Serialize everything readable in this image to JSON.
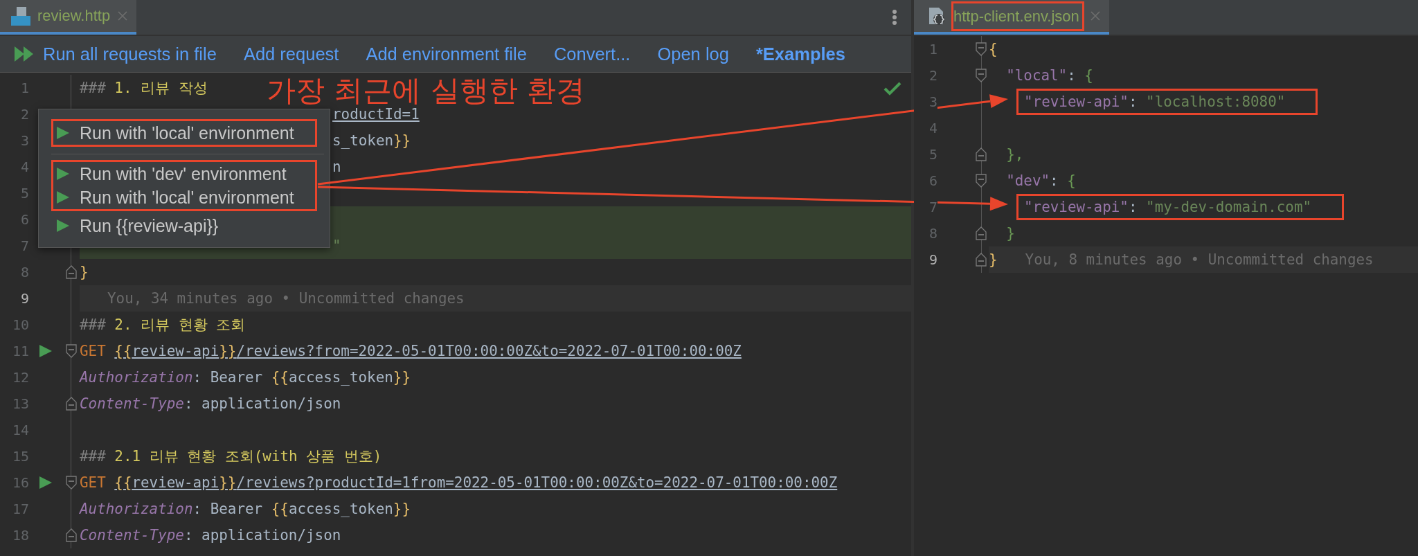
{
  "left_editor": {
    "tab": {
      "title": "review.http",
      "selected": true
    },
    "toolbar": [
      {
        "kind": "run",
        "label": "Run all requests in file"
      },
      {
        "kind": "link",
        "label": "Add request"
      },
      {
        "kind": "link",
        "label": "Add environment file"
      },
      {
        "kind": "link",
        "label": "Convert..."
      },
      {
        "kind": "link",
        "label": "Open log"
      },
      {
        "kind": "bold",
        "label": "*Examples"
      }
    ],
    "annotation": "가장 최근에 실행한 환경",
    "lines": [
      {
        "number": "1",
        "kind": "plain",
        "segments": [
          {
            "kind": "hash",
            "text": "###"
          },
          {
            "kind": "title",
            "text": " 1. 리뷰 작성"
          }
        ]
      },
      {
        "number": "2",
        "kind": "plain",
        "covered": true,
        "segments": [
          {
            "kind": "url",
            "text": "roductId=1"
          }
        ]
      },
      {
        "number": "3",
        "kind": "plain",
        "covered": true,
        "segments": [
          {
            "kind": "plain",
            "text": "s_token"
          },
          {
            "kind": "brace",
            "text": "}}"
          }
        ]
      },
      {
        "number": "4",
        "kind": "plain",
        "covered": true,
        "segments": [
          {
            "kind": "plain",
            "text": "n"
          }
        ]
      },
      {
        "number": "5",
        "kind": "plain"
      },
      {
        "number": "6",
        "kind": "plain",
        "changed": true
      },
      {
        "number": "7",
        "kind": "plain",
        "changed": true,
        "covered": true,
        "segments": [
          {
            "kind": "string",
            "text": "\""
          }
        ]
      },
      {
        "number": "8",
        "kind": "end",
        "segments": [
          {
            "kind": "brace",
            "text": "}"
          }
        ]
      },
      {
        "number": "9",
        "kind": "plain",
        "current": true,
        "blame": "You, 34 minutes ago • Uncommitted changes"
      },
      {
        "number": "10",
        "kind": "plain",
        "segments": [
          {
            "kind": "hash",
            "text": "###"
          },
          {
            "kind": "title",
            "text": " 2. 리뷰 현황 조회"
          }
        ]
      },
      {
        "number": "11",
        "kind": "start",
        "run": true,
        "segments": [
          {
            "kind": "method",
            "text": "GET "
          },
          {
            "kind": "linkbrace",
            "text": "{{"
          },
          {
            "kind": "var",
            "text": "review-api"
          },
          {
            "kind": "linkbrace",
            "text": "}}"
          },
          {
            "kind": "url",
            "text": "/reviews?from=2022-05-01T00:00:00Z&to=2022-07-01T00:00:00Z"
          }
        ]
      },
      {
        "number": "12",
        "kind": "plain",
        "segments": [
          {
            "kind": "header",
            "text": "Authorization"
          },
          {
            "kind": "plain",
            "text": ": Bearer "
          },
          {
            "kind": "brace",
            "text": "{{"
          },
          {
            "kind": "plain",
            "text": "access_token"
          },
          {
            "kind": "brace",
            "text": "}}"
          }
        ]
      },
      {
        "number": "13",
        "kind": "end",
        "segments": [
          {
            "kind": "header",
            "text": "Content-Type"
          },
          {
            "kind": "plain",
            "text": ": application/json"
          }
        ]
      },
      {
        "number": "14",
        "kind": "plain"
      },
      {
        "number": "15",
        "kind": "plain",
        "segments": [
          {
            "kind": "hash",
            "text": "###"
          },
          {
            "kind": "title",
            "text": " 2.1 리뷰 현황 조회(with 상품 번호)"
          }
        ]
      },
      {
        "number": "16",
        "kind": "start",
        "run": true,
        "segments": [
          {
            "kind": "method",
            "text": "GET "
          },
          {
            "kind": "linkbrace",
            "text": "{{"
          },
          {
            "kind": "var",
            "text": "review-api"
          },
          {
            "kind": "linkbrace",
            "text": "}}"
          },
          {
            "kind": "url",
            "text": "/reviews?productId=1from=2022-05-01T00:00:00Z&to=2022-07-01T00:00:00Z"
          }
        ]
      },
      {
        "number": "17",
        "kind": "plain",
        "segments": [
          {
            "kind": "header",
            "text": "Authorization"
          },
          {
            "kind": "plain",
            "text": ": Bearer "
          },
          {
            "kind": "brace",
            "text": "{{"
          },
          {
            "kind": "plain",
            "text": "access_token"
          },
          {
            "kind": "brace",
            "text": "}}"
          }
        ]
      },
      {
        "number": "18",
        "kind": "end",
        "segments": [
          {
            "kind": "header",
            "text": "Content-Type"
          },
          {
            "kind": "plain",
            "text": ": application/json"
          }
        ]
      }
    ]
  },
  "popup": {
    "groups": [
      {
        "boxed": true,
        "separator_after": true,
        "items": [
          {
            "label": "Run with 'local' environment"
          }
        ]
      },
      {
        "boxed": true,
        "items": [
          {
            "label": "Run with 'dev' environment"
          },
          {
            "label": "Run with 'local' environment"
          }
        ]
      },
      {
        "items": [
          {
            "label": "Run {{review-api}}"
          }
        ]
      }
    ]
  },
  "right_editor": {
    "tab": {
      "title": "http-client.env.json",
      "selected": true,
      "boxed": true
    },
    "lines": [
      {
        "number": "1",
        "kind": "start",
        "segments": [
          {
            "kind": "brace",
            "text": "{"
          }
        ]
      },
      {
        "number": "2",
        "kind": "start",
        "segments": [
          {
            "kind": "key",
            "text": "  \"local\""
          },
          {
            "kind": "plain",
            "text": ": "
          },
          {
            "kind": "jbrace",
            "text": "{"
          }
        ]
      },
      {
        "number": "3",
        "kind": "plain",
        "boxed": true,
        "segments": [
          {
            "kind": "key",
            "text": "\"review-api\""
          },
          {
            "kind": "plain",
            "text": ": "
          },
          {
            "kind": "string",
            "text": "\"localhost:8080\""
          }
        ]
      },
      {
        "number": "4",
        "kind": "plain"
      },
      {
        "number": "5",
        "kind": "end",
        "segments": [
          {
            "kind": "jbrace",
            "text": "  },"
          }
        ]
      },
      {
        "number": "6",
        "kind": "start",
        "segments": [
          {
            "kind": "key",
            "text": "  \"dev\""
          },
          {
            "kind": "plain",
            "text": ": "
          },
          {
            "kind": "jbrace",
            "text": "{"
          }
        ]
      },
      {
        "number": "7",
        "kind": "plain",
        "boxed": true,
        "segments": [
          {
            "kind": "key",
            "text": "\"review-api\""
          },
          {
            "kind": "plain",
            "text": ": "
          },
          {
            "kind": "string",
            "text": "\"my-dev-domain.com\""
          }
        ]
      },
      {
        "number": "8",
        "kind": "end",
        "segments": [
          {
            "kind": "jbrace",
            "text": "  }"
          }
        ]
      },
      {
        "number": "9",
        "kind": "end",
        "current": true,
        "segments": [
          {
            "kind": "brace",
            "text": "}"
          }
        ],
        "blame": "You, 8 minutes ago • Uncommitted changes"
      }
    ]
  }
}
